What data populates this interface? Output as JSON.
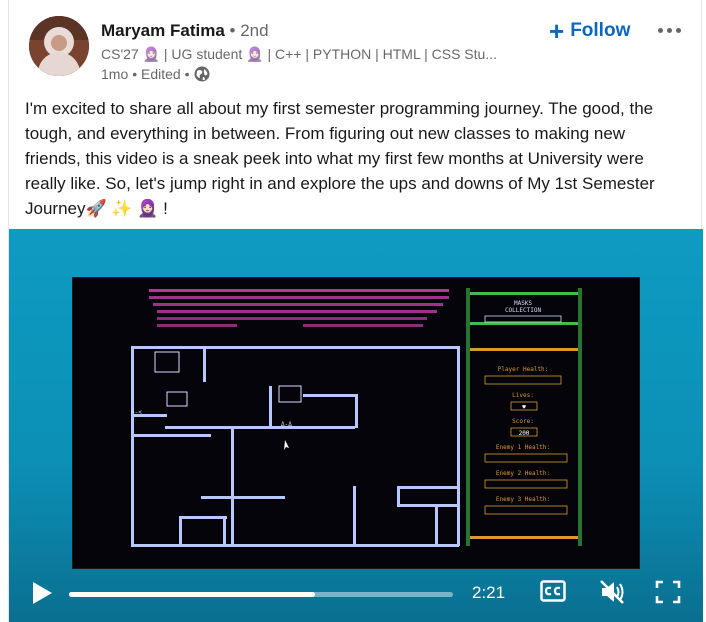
{
  "author": {
    "name": "Maryam Fatima",
    "degree": "• 2nd",
    "headline": "CS'27 🧕🏻 | UG student 🧕🏻 | C++ | PYTHON | HTML | CSS Stu...",
    "time_ago": "1mo",
    "edited": "• Edited •",
    "visibility_icon": "globe-icon"
  },
  "actions": {
    "follow_label": "Follow",
    "more_icon": "more-options-icon"
  },
  "post": {
    "text": "I'm excited to share all about my first semester programming journey. The good, the tough, and everything in between. From figuring out new classes to making new friends, this video is a sneak peek into what my first few months at University were really like. So, let's jump right in and explore the ups and downs of My 1st Semester Journey🚀 ✨ 🧕🏻 !"
  },
  "video": {
    "time_remaining": "2:21",
    "progress": 0.64,
    "game": {
      "hud_title_a": "MASKS",
      "hud_title_b": "COLLECTION",
      "player_health_label": "Player Health:",
      "lives_label": "Lives:",
      "lives_value": "♥",
      "score_label": "Score:",
      "score_value": "200",
      "enemy1_label": "Enemy 1 Health:",
      "enemy2_label": "Enemy 2 Health:",
      "enemy3_label": "Enemy 3 Health:"
    }
  },
  "colors": {
    "accent": "#0a66c2",
    "video_bg": "#0c93ba",
    "game_pink": "#c53fa9",
    "game_wall": "#b8c8ff",
    "game_green": "#3fbf4a",
    "game_orange": "#d99a2b"
  }
}
